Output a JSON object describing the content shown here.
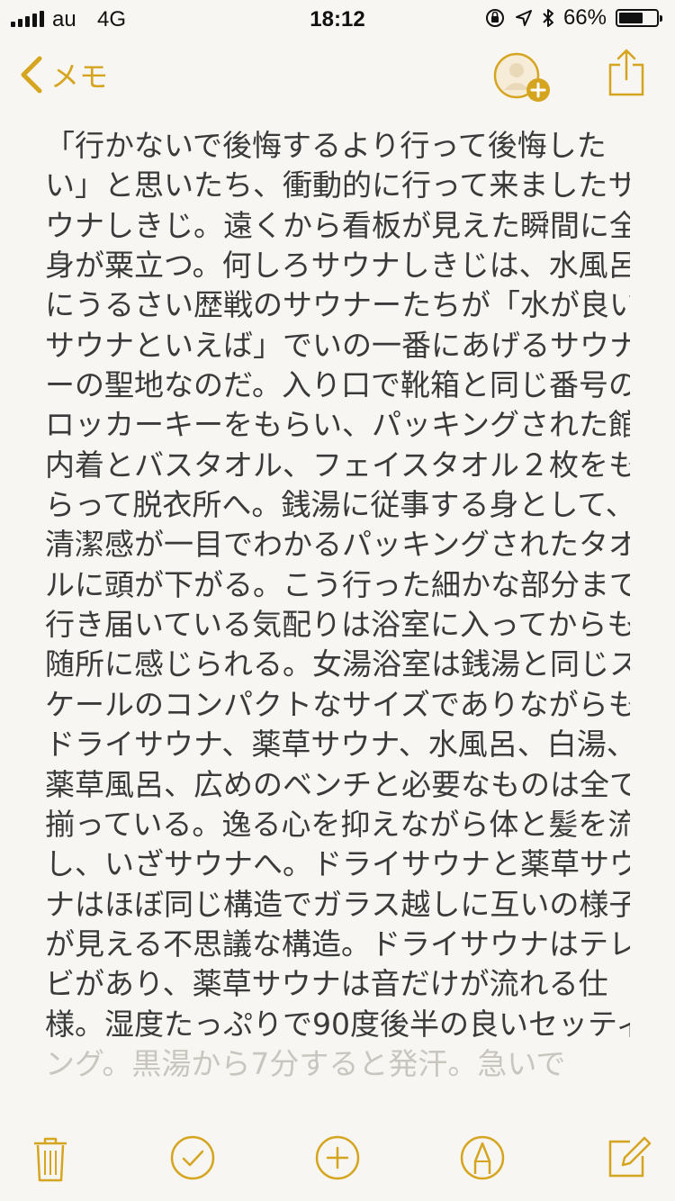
{
  "status_bar": {
    "carrier": "au",
    "network": "4G",
    "time": "18:12",
    "battery_percent": "66%",
    "battery_level": 0.66
  },
  "nav": {
    "back_label": "メモ"
  },
  "note": {
    "lines": [
      "「行かないで後悔するより行って後悔した",
      "い」と思いたち、衝動的に行って来ましたサ",
      "ウナしきじ。遠くから看板が見えた瞬間に全",
      "身が粟立つ。何しろサウナしきじは、水風呂",
      "にうるさい歴戦のサウナーたちが「水が良い",
      "サウナといえば」でいの一番にあげるサウナ",
      "ーの聖地なのだ。入り口で靴箱と同じ番号の",
      "ロッカーキーをもらい、パッキングされた館",
      "内着とバスタオル、フェイスタオル２枚をも",
      "らって脱衣所へ。銭湯に従事する身として、",
      "清潔感が一目でわかるパッキングされたタオ",
      "ルに頭が下がる。こう行った細かな部分まで",
      "行き届いている気配りは浴室に入ってからも",
      "随所に感じられる。女湯浴室は銭湯と同じス",
      "ケールのコンパクトなサイズでありながらも",
      "ドライサウナ、薬草サウナ、水風呂、白湯、",
      "薬草風呂、広めのベンチと必要なものは全て",
      "揃っている。逸る心を抑えながら体と髪を流",
      "し、いざサウナへ。ドライサウナと薬草サウ",
      "ナはほぼ同じ構造でガラス越しに互いの様子",
      "が見える不思議な構造。ドライサウナはテレ",
      "ビがあり、薬草サウナは音だけが流れる仕",
      "様。湿度たっぷりで90度後半の良いセッティ"
    ],
    "faint_line": "ング。黒湯から7分すると発汗。急いで"
  },
  "colors": {
    "accent": "#d6a520",
    "background": "#f7f6f3",
    "text": "#3a3a3a"
  },
  "icons": {
    "back": "chevron-left-icon",
    "add_person": "add-person-icon",
    "share": "share-icon",
    "trash": "trash-icon",
    "checklist": "checkmark-circle-icon",
    "add": "plus-circle-icon",
    "sketch": "pen-circle-icon",
    "compose": "compose-icon"
  }
}
